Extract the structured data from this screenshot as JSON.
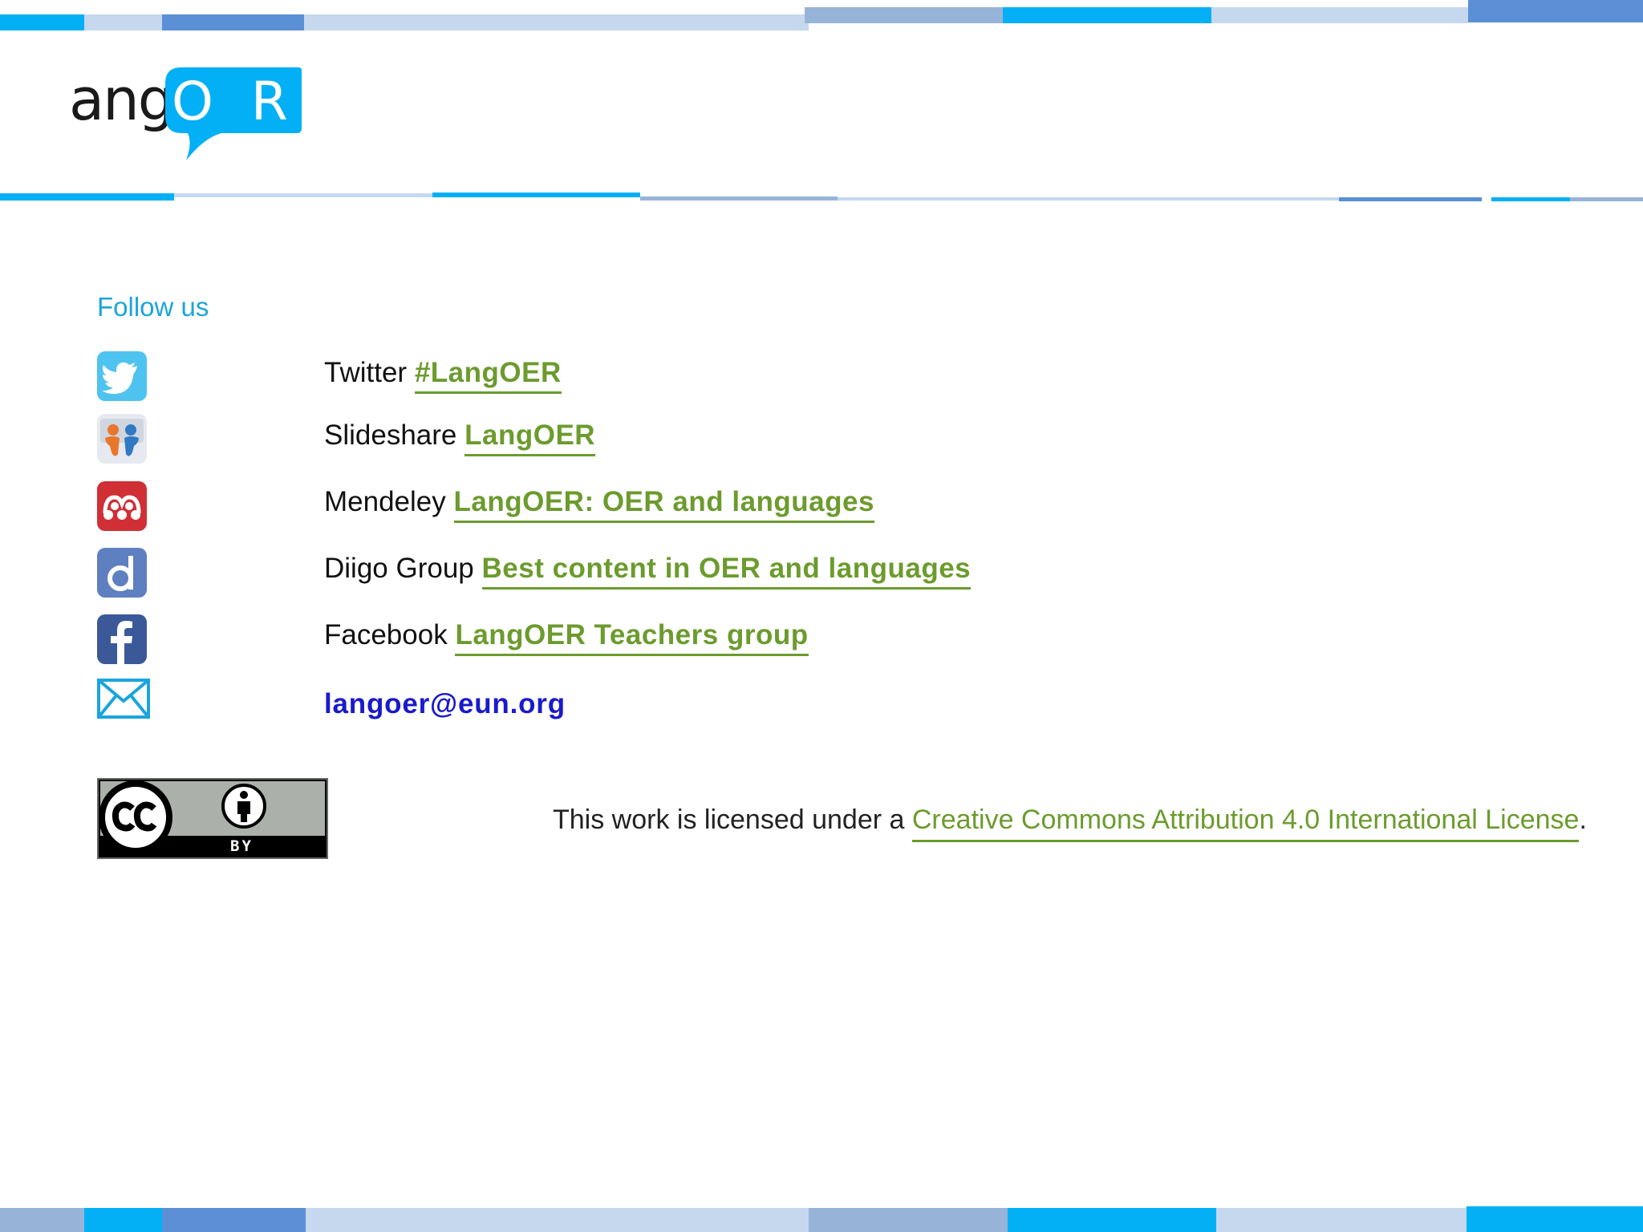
{
  "logo": {
    "wordmark_left": "ang",
    "wordmark_bubble": "O R"
  },
  "follow": {
    "heading": "Follow us",
    "items": [
      {
        "service": "Twitter",
        "link": "#LangOER",
        "icon": "twitter-icon"
      },
      {
        "service": "Slideshare",
        "link": "LangOER",
        "icon": "slideshare-icon"
      },
      {
        "service": "Mendeley",
        "link": "LangOER: OER and languages",
        "icon": "mendeley-icon"
      },
      {
        "service": "Diigo Group",
        "link": "Best content in OER and languages",
        "icon": "diigo-icon"
      },
      {
        "service": "Facebook",
        "link": "LangOER Teachers group",
        "icon": "facebook-icon"
      }
    ],
    "email": "langoer@eun.org",
    "email_icon": "envelope-icon"
  },
  "license": {
    "badge_icon": "cc-by-badge-icon",
    "badge_text": "BY",
    "prefix": "This work is licensed under a ",
    "link": "Creative Commons Attribution 4.0 International License",
    "suffix": "."
  },
  "colors": {
    "accent_blue": "#1ba5dd",
    "link_green": "#6c9b2e",
    "email_blue": "#1a1acc",
    "bar_cyan": "#03b0f5",
    "bar_mid": "#5b8fd6",
    "bar_light": "#c5d8ee",
    "bar_grey": "#98b3d8"
  }
}
